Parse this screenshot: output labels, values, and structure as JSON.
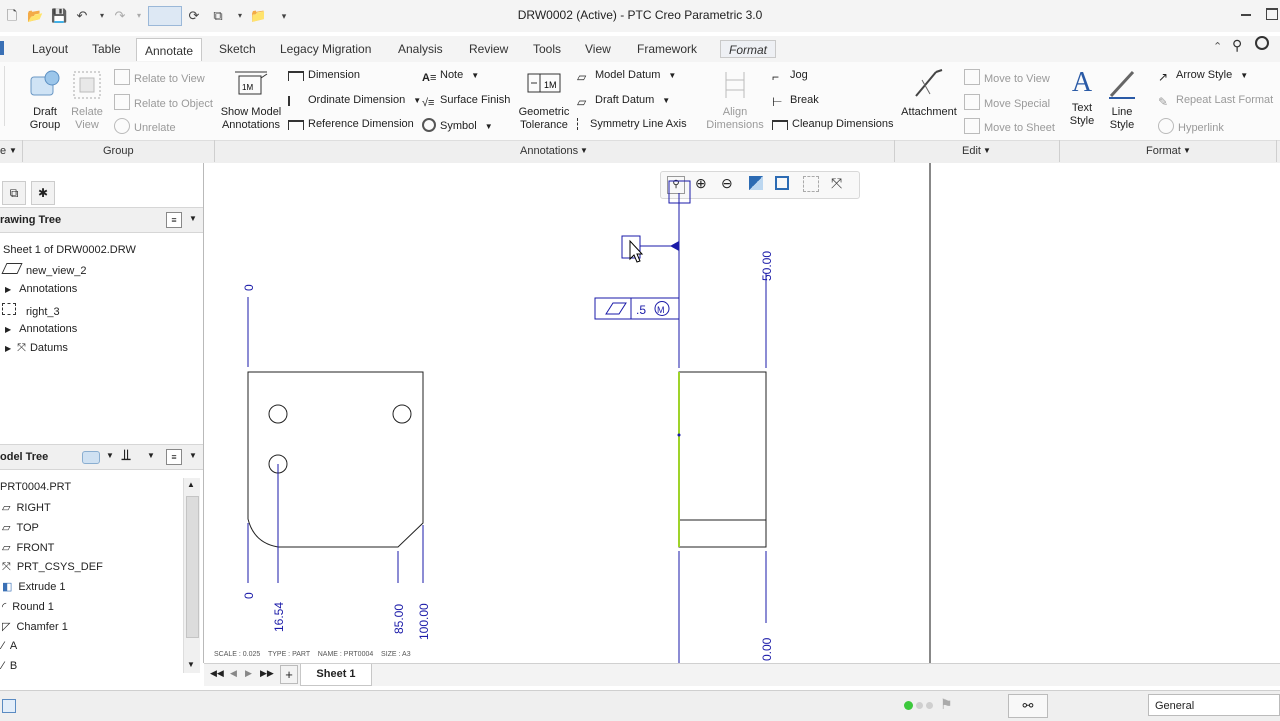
{
  "window": {
    "title": "DRW0002 (Active) - PTC Creo Parametric 3.0"
  },
  "tabs": [
    "Layout",
    "Table",
    "Annotate",
    "Sketch",
    "Legacy Migration",
    "Analysis",
    "Review",
    "Tools",
    "View",
    "Framework",
    "Format"
  ],
  "ribbon": {
    "draft_group": "Draft\nGroup",
    "relate_view": "Relate\nView",
    "relate_to_view": "Relate to View",
    "relate_to_object": "Relate to Object",
    "unrelate": "Unrelate",
    "show_model_annotations": "Show Model\nAnnotations",
    "dimension": "Dimension",
    "ordinate_dimension": "Ordinate Dimension",
    "reference_dimension": "Reference Dimension",
    "note": "Note",
    "surface_finish": "Surface Finish",
    "symbol": "Symbol",
    "geometric_tolerance": "Geometric\nTolerance",
    "model_datum": "Model Datum",
    "draft_datum": "Draft Datum",
    "symmetry_line_axis": "Symmetry Line Axis",
    "align_dimensions": "Align\nDimensions",
    "jog": "Jog",
    "break": "Break",
    "cleanup_dimensions": "Cleanup Dimensions",
    "attachment": "Attachment",
    "move_to_view": "Move to View",
    "move_special": "Move Special",
    "move_to_sheet": "Move to Sheet",
    "text_style": "Text\nStyle",
    "line_style": "Line\nStyle",
    "arrow_style": "Arrow Style",
    "repeat_last_format": "Repeat Last Format",
    "hyperlink": "Hyperlink"
  },
  "groups": {
    "left_e": "e",
    "group": "Group",
    "annotations": "Annotations",
    "edit": "Edit",
    "format": "Format"
  },
  "drawing_tree": {
    "title": "rawing Tree",
    "items": [
      "Sheet 1 of DRW0002.DRW",
      "new_view_2",
      "Annotations",
      "right_3",
      "Annotations",
      "Datums"
    ]
  },
  "model_tree": {
    "title": "odel Tree",
    "items": [
      "PRT0004.PRT",
      "RIGHT",
      "TOP",
      "FRONT",
      "PRT_CSYS_DEF",
      "Extrude 1",
      "Round 1",
      "Chamfer 1",
      "A",
      "B"
    ]
  },
  "drawing": {
    "dims_left": [
      "0",
      "0",
      "16.54",
      "85.00",
      "100.00"
    ],
    "dims_right": [
      "50.00",
      "0.00"
    ],
    "gtol_value": ".5",
    "gtol_modifier": "M",
    "info": "SCALE : 0.025    TYPE : PART    NAME : PRT0004    SIZE : A3"
  },
  "sheet": {
    "tab": "Sheet 1"
  },
  "status": {
    "filter": "General"
  },
  "colors": {
    "accent_dim": "#1a1aa8",
    "highlight": "#9fd32a",
    "selection_green": "#3cc83c"
  }
}
